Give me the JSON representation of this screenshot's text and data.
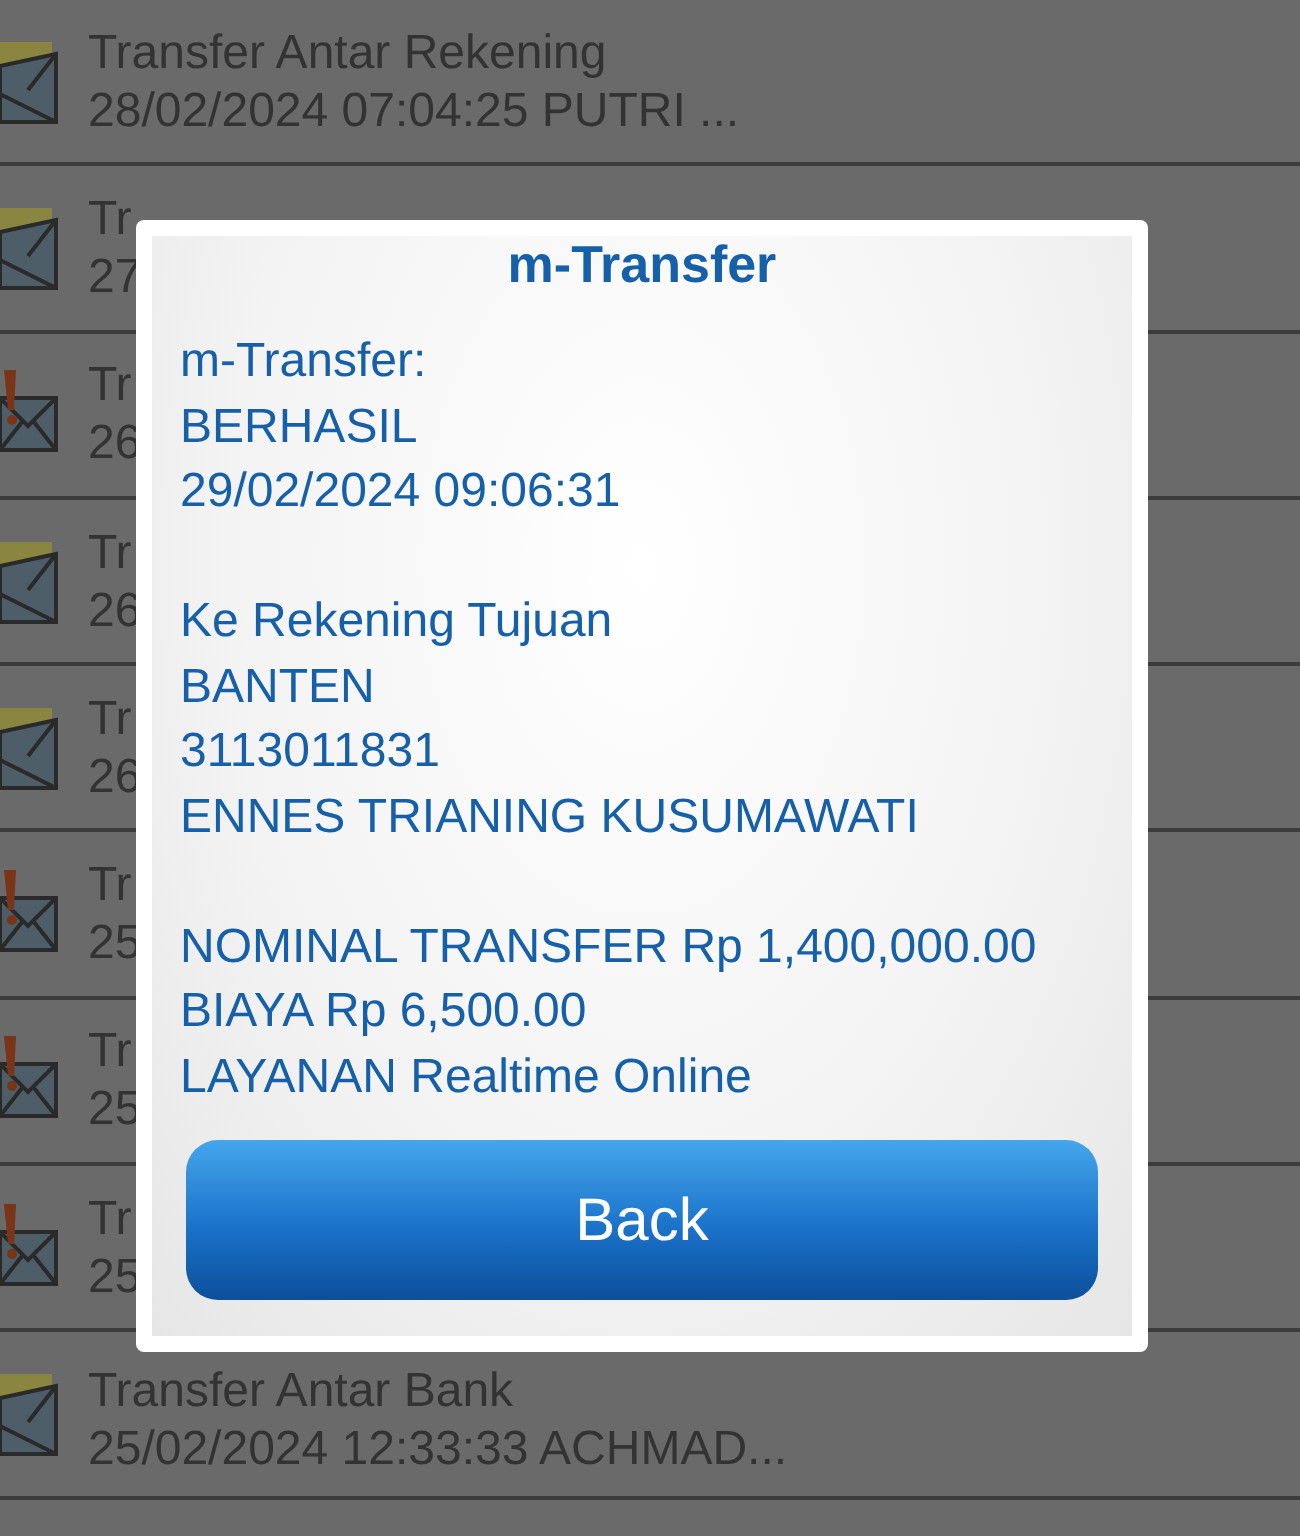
{
  "list": [
    {
      "kind": "read",
      "title": "Transfer Antar Rekening",
      "subtitle": "28/02/2024 07:04:25 PUTRI ..."
    },
    {
      "kind": "read",
      "title": "Tr",
      "subtitle": "27"
    },
    {
      "kind": "alert",
      "title": "Tr",
      "subtitle": "26"
    },
    {
      "kind": "read",
      "title": "Tr",
      "subtitle": "26"
    },
    {
      "kind": "read",
      "title": "Tr",
      "subtitle": "26"
    },
    {
      "kind": "alert",
      "title": "Tr",
      "subtitle": "25"
    },
    {
      "kind": "alert",
      "title": "Tr",
      "subtitle": "25"
    },
    {
      "kind": "alert",
      "title": "Tr",
      "subtitle": "25"
    },
    {
      "kind": "read",
      "title": "Transfer Antar Bank",
      "subtitle": "25/02/2024 12:33:33 ACHMAD..."
    }
  ],
  "dialog": {
    "title": "m-Transfer",
    "paragraphs": [
      [
        "m-Transfer:",
        "BERHASIL",
        "29/02/2024 09:06:31"
      ],
      [
        "Ke Rekening Tujuan",
        "BANTEN",
        "3113011831",
        "ENNES TRIANING KUSUMAWATI"
      ],
      [
        "NOMINAL TRANSFER Rp 1,400,000.00",
        "BIAYA Rp 6,500.00",
        "LAYANAN Realtime Online"
      ]
    ],
    "button": "Back"
  }
}
